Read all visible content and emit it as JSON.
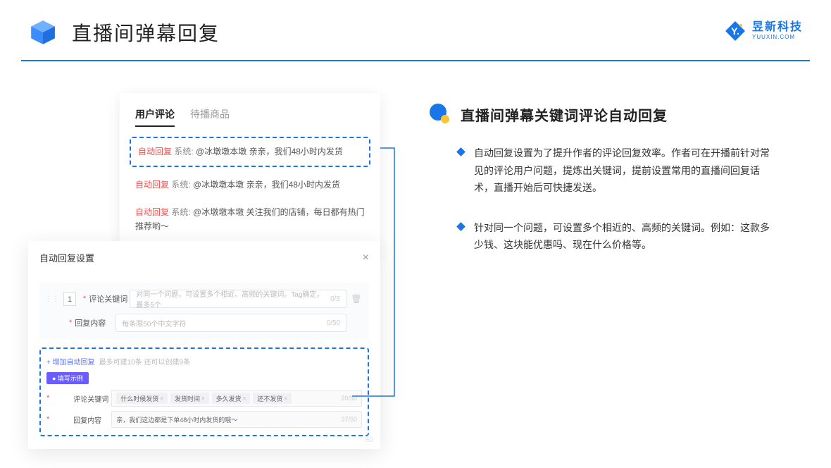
{
  "header": {
    "title": "直播间弹幕回复",
    "brand_name": "昱新科技",
    "brand_sub": "YUUXIN.COM"
  },
  "comments": {
    "tab_active": "用户评论",
    "tab_other": "待播商品",
    "rows": [
      {
        "tag": "自动回复",
        "sys": "系统:",
        "body": "@冰墩墩本墩 亲亲，我们48小时内发货"
      },
      {
        "tag": "自动回复",
        "sys": "系统:",
        "body": "@冰墩墩本墩 亲亲，我们48小时内发货"
      },
      {
        "tag": "自动回复",
        "sys": "系统:",
        "body": "@冰墩墩本墩 关注我们的店铺，每日都有热门推荐哟～"
      }
    ]
  },
  "settings": {
    "title": "自动回复设置",
    "number": "1",
    "kw_label": "评论关键词",
    "kw_placeholder": "对同一个问题，可设置多个相近、高频的关键词。Tag确定，最多5个",
    "kw_counter": "0/5",
    "reply_label": "回复内容",
    "reply_placeholder": "每条限50个中文字符",
    "reply_counter": "0/50",
    "add_link": "+ 增加自动回复",
    "add_sub": "最多可建10条 还可以创建9条",
    "example_badge": "● 填写示例",
    "ex_kw_label": "评论关键词",
    "ex_kw_counter": "20/50",
    "ex_tags": [
      "什么时候发货",
      "发货时间",
      "多久发货",
      "还不发货"
    ],
    "ex_reply_label": "回复内容",
    "ex_reply_text": "亲，我们这边都是下单48小时内发货的哦～",
    "ex_reply_counter": "37/50",
    "ghost": "/50"
  },
  "right": {
    "heading": "直播间弹幕关键词评论自动回复",
    "bullets": [
      "自动回复设置为了提升作者的评论回复效率。作者可在开播前针对常见的评论用户问题，提炼出关键词，提前设置常用的直播间回复话术，直播开始后可快捷发送。",
      "针对同一个问题，可设置多个相近的、高频的关键词。例如：这款多少钱、这块能优惠吗、现在什么价格等。"
    ]
  }
}
